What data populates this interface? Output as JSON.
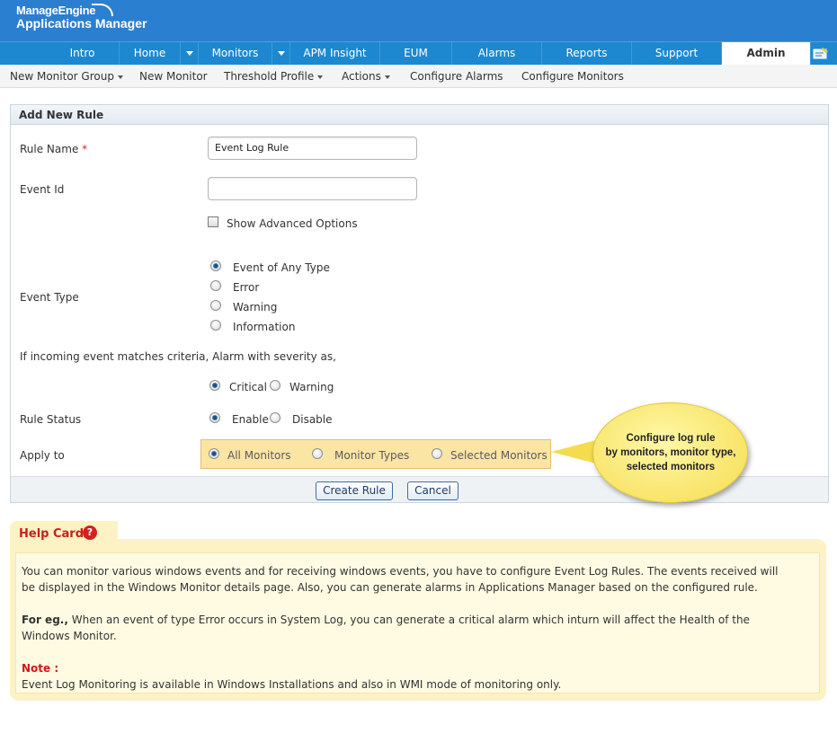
{
  "header": {
    "brand": "ManageEngine",
    "product": "Applications Manager"
  },
  "main_nav": [
    {
      "label": "Intro"
    },
    {
      "label": "Home"
    },
    {
      "label": "Monitors"
    },
    {
      "label": "APM Insight"
    },
    {
      "label": "EUM"
    },
    {
      "label": "Alarms"
    },
    {
      "label": "Reports"
    },
    {
      "label": "Support"
    },
    {
      "label": "Admin",
      "active": true
    }
  ],
  "sub_nav": [
    {
      "label": "New Monitor Group",
      "dropdown": true
    },
    {
      "label": "New Monitor",
      "dropdown": false
    },
    {
      "label": "Threshold Profile",
      "dropdown": true
    },
    {
      "label": "Actions",
      "dropdown": true
    },
    {
      "label": "Configure Alarms",
      "dropdown": false
    },
    {
      "label": "Configure Monitors",
      "dropdown": false
    }
  ],
  "form": {
    "title": "Add New Rule",
    "rule_name_label": "Rule Name",
    "required_mark": "*",
    "rule_name_value": "Event Log Rule",
    "event_id_label": "Event Id",
    "event_id_value": "",
    "advanced_label": "Show Advanced Options",
    "event_type_label": "Event Type",
    "event_types": [
      "Event of Any Type",
      "Error",
      "Warning",
      "Information"
    ],
    "event_type_selected": "Event of Any Type",
    "severity_prompt": "If incoming event matches criteria, Alarm with severity as,",
    "severity_options": [
      "Critical",
      "Warning"
    ],
    "severity_selected": "Critical",
    "status_label": "Rule Status",
    "status_options": [
      "Enable",
      "Disable"
    ],
    "status_selected": "Enable",
    "apply_label": "Apply to",
    "apply_options": [
      "All Monitors",
      "Monitor Types",
      "Selected Monitors"
    ],
    "apply_selected": "All Monitors",
    "create_button": "Create Rule",
    "cancel_button": "Cancel"
  },
  "callout": {
    "line1": "Configure log rule",
    "line2": "by monitors, monitor type,",
    "line3": "selected monitors"
  },
  "help": {
    "title": "Help Card",
    "help_icon": "?",
    "para1": "You can monitor various windows events and for receiving windows events, you have to configure Event Log Rules. The events received will be displayed in the Windows Monitor details page. Also, you can generate alarms in Applications Manager based on the configured rule.",
    "example_label": "For eg.,",
    "para2": "When an event of type Error occurs in System Log, you can generate a critical alarm which inturn will affect the Health of the Windows Monitor.",
    "note_label": "Note :",
    "note_text": "Event Log Monitoring is available in Windows Installations and also in WMI mode of monitoring only."
  },
  "colors": {
    "header_blue": "#2b7fd0",
    "nav_blue": "#1d88cf",
    "note_red": "#d01818",
    "help_bg": "#fcf2c4",
    "apply_highlight": "#fbe5a5",
    "callout_yellow": "#f5dc4e"
  }
}
